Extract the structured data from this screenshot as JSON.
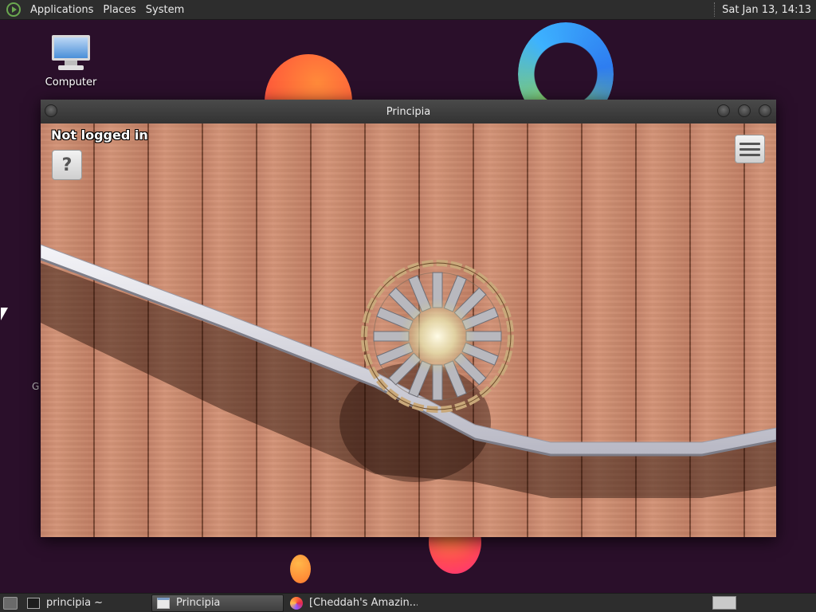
{
  "top_panel": {
    "menus": [
      "Applications",
      "Places",
      "System"
    ],
    "clock": "Sat Jan 13, 14:13"
  },
  "desktop": {
    "icons": [
      {
        "label": "Computer",
        "icon": "computer-icon"
      }
    ],
    "stray_text": "G"
  },
  "window": {
    "title": "Principia",
    "status": "Not logged in",
    "help_label": "?",
    "menu_icon": "hamburger-menu-icon"
  },
  "taskbar": {
    "tasks": [
      {
        "label": "principia ~",
        "icon": "terminal-icon",
        "active": false
      },
      {
        "label": "Principia",
        "icon": "window-icon",
        "active": true
      },
      {
        "label": "[Cheddah's Amazin...",
        "icon": "browser-icon",
        "active": false
      }
    ]
  },
  "colors": {
    "desktop_bg": "#2a0f2a",
    "panel_bg": "#2d2d2d",
    "wood": "#c98a6e",
    "track": "#e8e8ee"
  }
}
